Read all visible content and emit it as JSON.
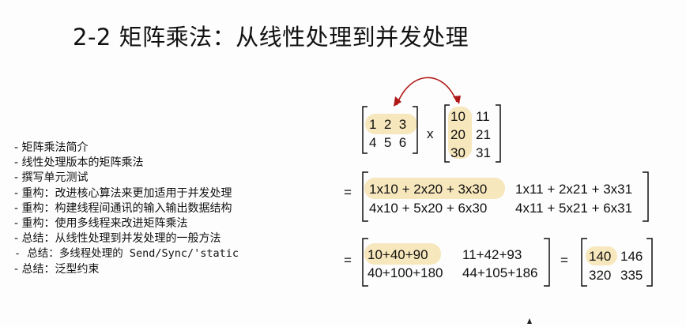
{
  "title": "2-2 矩阵乘法：从线性处理到并发处理",
  "agenda": [
    "- 矩阵乘法简介",
    "- 线性处理版本的矩阵乘法",
    "- 撰写单元测试",
    "- 重构：改进核心算法来更加适用于并发处理",
    "- 重构：构建线程间通讯的输入输出数据结构",
    "- 重构：使用多线程来改进矩阵乘法",
    "- 总结：从线性处理到并发处理的一般方法",
    "- 总结：多线程处理的 Send/Sync/'static",
    "- 总结：泛型约束"
  ],
  "matrix_a": {
    "row1": "1  2  3",
    "row2": "4  5  6"
  },
  "times": "x",
  "matrix_b": {
    "r1c1": "10",
    "r1c2": "11",
    "r2c1": "20",
    "r2c2": "21",
    "r3c1": "30",
    "r3c2": "31"
  },
  "equals": "=",
  "expansion": {
    "r1c1": "1x10 + 2x20 + 3x30",
    "r1c2": "1x11 + 2x21 + 3x31",
    "r2c1": "4x10 + 5x20 + 6x30",
    "r2c2": "4x11 + 5x21 + 6x31"
  },
  "sums": {
    "r1c1": "10+40+90",
    "r1c2": "11+42+93",
    "r2c1": "40+100+180",
    "r2c2": "44+105+186"
  },
  "result": {
    "r1c1": "140",
    "r1c2": "146",
    "r2c1": "320",
    "r2c2": "335"
  },
  "colors": {
    "highlight": "#f6e3b0",
    "arrow": "#b01818"
  }
}
